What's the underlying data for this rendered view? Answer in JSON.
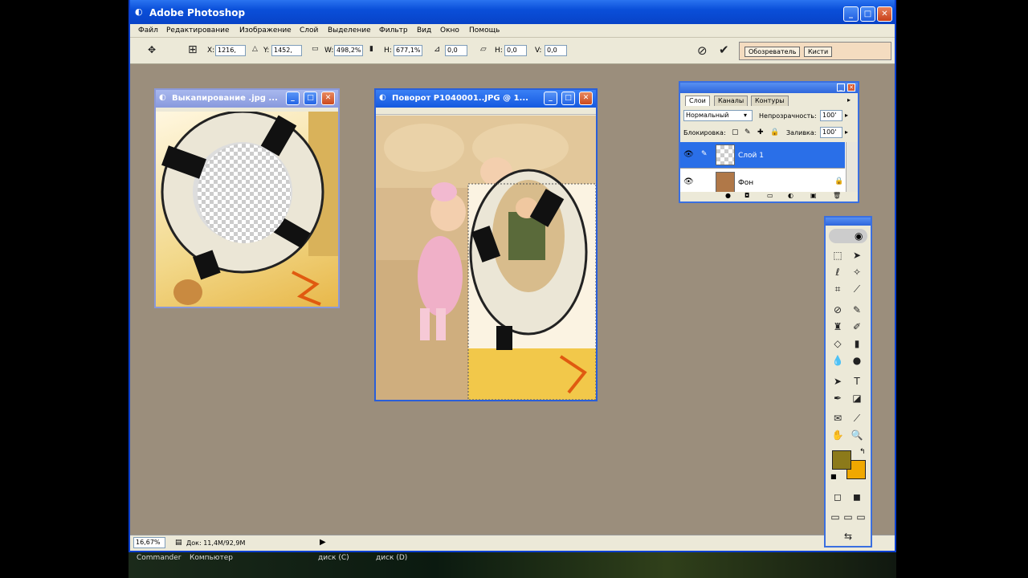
{
  "app": {
    "title": "Adobe Photoshop",
    "menu": [
      "Файл",
      "Редактирование",
      "Изображение",
      "Слой",
      "Выделение",
      "Фильтр",
      "Вид",
      "Окно",
      "Помощь"
    ]
  },
  "options": {
    "x_label": "X:",
    "x_value": "1216,",
    "y_label": "Y:",
    "y_value": "1452,",
    "w_label": "W:",
    "w_value": "498,2%",
    "h_label": "H:",
    "h_value": "677,1%",
    "angle_value": "0,0",
    "hskew_label": "H:",
    "hskew_value": "0,0",
    "vskew_label": "V:",
    "vskew_value": "0,0",
    "well_tabs": [
      "Обозреватель",
      "Кисти"
    ]
  },
  "documents": [
    {
      "title": "Выкапирование .jpg ..."
    },
    {
      "title": "Поворот P1040001..JPG @ 1..."
    }
  ],
  "layers_panel": {
    "tabs": [
      "Слои",
      "Каналы",
      "Контуры"
    ],
    "blend_mode": "Нормальный",
    "opacity_label": "Непрозрачность:",
    "opacity_value": "100'",
    "lock_label": "Блокировка:",
    "fill_label": "Заливка:",
    "fill_value": "100'",
    "layers": [
      {
        "name": "Слой 1",
        "selected": true
      },
      {
        "name": "Фон",
        "selected": false
      }
    ]
  },
  "toolbox": {
    "foreground_color": "#8c7a1a",
    "background_color": "#f0a800"
  },
  "status": {
    "zoom": "16,67%",
    "doc_info": "Док: 11,4М/92,9М"
  },
  "taskbar": {
    "items": [
      "Commander",
      "Компьютер",
      "диск (C)",
      "диск (D)"
    ]
  }
}
